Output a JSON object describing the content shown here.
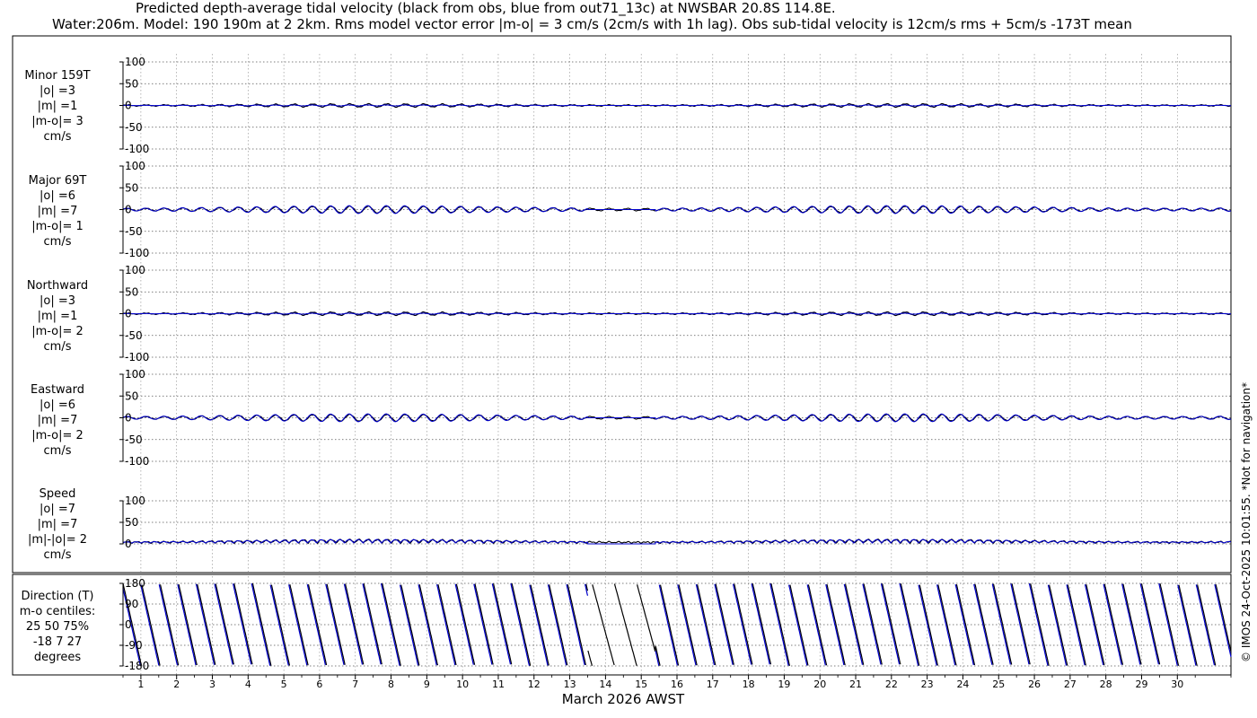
{
  "title": {
    "line1": "Predicted depth-average tidal velocity (black from obs, blue from out71_13c) at NWSBAR 20.8S 114.8E.",
    "line2": "Water:206m. Model: 190 190m at 2 2km. Rms model vector error |m-o| = 3 cm/s (2cm/s with 1h lag). Obs sub-tidal velocity is 12cm/s rms + 5cm/s -173T mean"
  },
  "copyright": "© IMOS 24-Oct-2025 10:01:55. *Not for navigation*",
  "colors": {
    "obs": "#000000",
    "model": "#0000cc",
    "grid": "#555555"
  },
  "chart_data": [
    {
      "type": "line",
      "panel": "Minor 159T",
      "label_lines": [
        "Minor 159T",
        "|o| =3",
        "|m| =1",
        "|m-o|= 3",
        "cm/s"
      ],
      "ylim": [
        -100,
        100
      ],
      "yticks": [
        100,
        50,
        0,
        -50,
        -100
      ],
      "series": [
        {
          "name": "obs",
          "amplitude_cm_s": 3
        },
        {
          "name": "model",
          "amplitude_cm_s": 1
        }
      ]
    },
    {
      "type": "line",
      "panel": "Major 69T",
      "label_lines": [
        "Major 69T",
        "|o| =6",
        "|m| =7",
        "|m-o|= 1",
        "cm/s"
      ],
      "ylim": [
        -100,
        100
      ],
      "yticks": [
        100,
        50,
        0,
        -50,
        -100
      ],
      "series": [
        {
          "name": "obs",
          "amplitude_cm_s": 6
        },
        {
          "name": "model",
          "amplitude_cm_s": 7
        }
      ]
    },
    {
      "type": "line",
      "panel": "Northward",
      "label_lines": [
        "Northward",
        "|o| =3",
        "|m| =1",
        "|m-o|= 2",
        "cm/s"
      ],
      "ylim": [
        -100,
        100
      ],
      "yticks": [
        100,
        50,
        0,
        -50,
        -100
      ],
      "series": [
        {
          "name": "obs",
          "amplitude_cm_s": 3
        },
        {
          "name": "model",
          "amplitude_cm_s": 1
        }
      ]
    },
    {
      "type": "line",
      "panel": "Eastward",
      "label_lines": [
        "Eastward",
        "|o| =6",
        "|m| =7",
        "|m-o|= 2",
        "cm/s"
      ],
      "ylim": [
        -100,
        100
      ],
      "yticks": [
        100,
        50,
        0,
        -50,
        -100
      ],
      "series": [
        {
          "name": "obs",
          "amplitude_cm_s": 6
        },
        {
          "name": "model",
          "amplitude_cm_s": 7
        }
      ]
    },
    {
      "type": "line",
      "panel": "Speed",
      "label_lines": [
        "Speed",
        "|o| =7",
        "|m| =7",
        "|m|-|o|= 2",
        "cm/s"
      ],
      "ylim": [
        0,
        100
      ],
      "yticks": [
        100,
        50,
        0
      ],
      "series": [
        {
          "name": "obs",
          "amplitude_cm_s": 7
        },
        {
          "name": "model",
          "amplitude_cm_s": 7
        }
      ]
    },
    {
      "type": "line",
      "panel": "Direction (T)",
      "label_lines": [
        "Direction (T)",
        "m-o centiles:",
        "25  50  75%",
        "-18   7  27",
        "degrees"
      ],
      "ylim": [
        -180,
        180
      ],
      "yticks": [
        180,
        90,
        0,
        -90,
        -180
      ],
      "series": [
        {
          "name": "obs",
          "unit": "degrees T"
        },
        {
          "name": "model",
          "unit": "degrees T"
        }
      ]
    }
  ],
  "x_axis": {
    "label": "March 2026 AWST",
    "days": [
      "1",
      "2",
      "3",
      "4",
      "5",
      "6",
      "7",
      "8",
      "9",
      "10",
      "11",
      "12",
      "13",
      "14",
      "15",
      "16",
      "17",
      "18",
      "19",
      "20",
      "21",
      "22",
      "23",
      "24",
      "25",
      "26",
      "27",
      "28",
      "29",
      "30"
    ],
    "range_days": [
      0,
      31
    ],
    "model_gap_days": [
      13,
      14.9
    ]
  }
}
